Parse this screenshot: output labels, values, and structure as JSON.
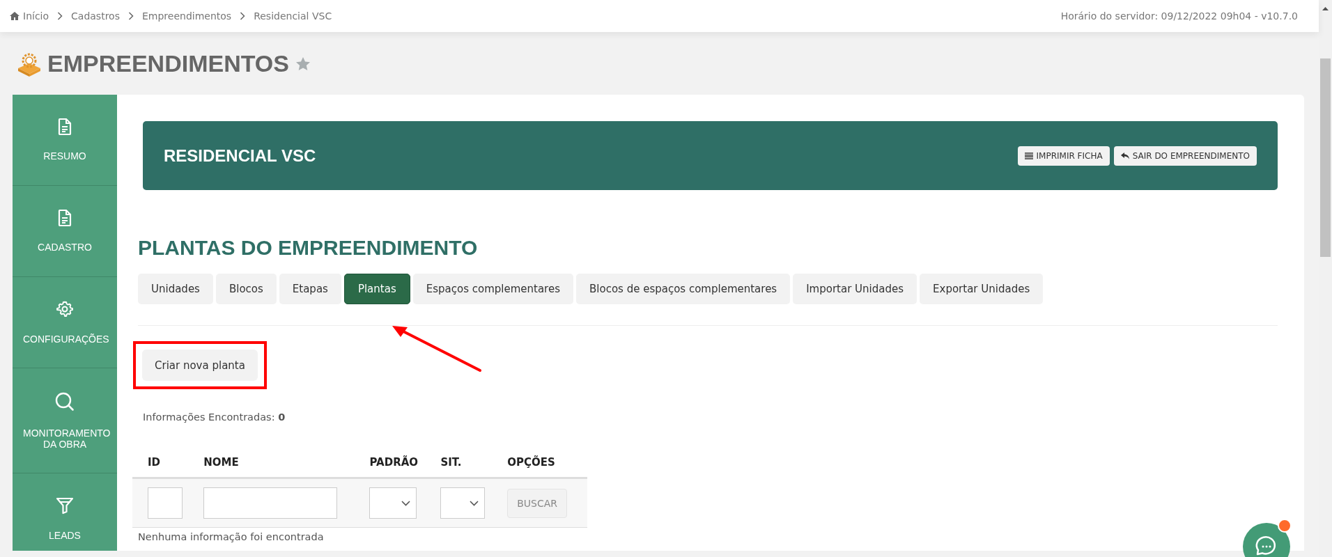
{
  "breadcrumb": [
    {
      "label": "Início",
      "kind": "home"
    },
    {
      "label": "Cadastros",
      "kind": "link"
    },
    {
      "label": "Empreendimentos",
      "kind": "link"
    },
    {
      "label": "Residencial VSC",
      "kind": "link"
    }
  ],
  "server_info": "Horário do servidor: 09/12/2022 09h04 - v10.7.0",
  "page": {
    "title": "EMPREENDIMENTOS",
    "favorite": false
  },
  "sidebar": {
    "items": [
      {
        "label": "RESUMO",
        "kind": "document"
      },
      {
        "label": "CADASTRO",
        "kind": "document"
      },
      {
        "label": "CONFIGURAÇÕES",
        "kind": "gear"
      },
      {
        "label": "MONITORAMENTO DA OBRA",
        "kind": "search"
      },
      {
        "label": "LEADS",
        "kind": "funnel"
      }
    ]
  },
  "header": {
    "title": "RESIDENCIAL VSC",
    "buttons": [
      {
        "label": "IMPRIMIR FICHA",
        "kind": "print"
      },
      {
        "label": "SAIR DO EMPREENDIMENTO",
        "kind": "exit"
      }
    ]
  },
  "section": {
    "title": "PLANTAS DO EMPREENDIMENTO"
  },
  "tabs": [
    {
      "label": "Unidades",
      "selected": false
    },
    {
      "label": "Blocos",
      "selected": false
    },
    {
      "label": "Etapas",
      "selected": false
    },
    {
      "label": "Plantas",
      "selected": true
    },
    {
      "label": "Espaços complementares",
      "selected": false
    },
    {
      "label": "Blocos de espaços complementares",
      "selected": false
    },
    {
      "label": "Importar Unidades",
      "selected": false
    },
    {
      "label": "Exportar Unidades",
      "selected": false
    }
  ],
  "create_button": {
    "label": "Criar nova planta",
    "highlighted": true
  },
  "results": {
    "label": "Informações Encontradas:",
    "count": "0"
  },
  "table": {
    "columns": [
      "ID",
      "NOME",
      "PADRÃO",
      "SIT.",
      "OPÇÕES"
    ],
    "filters": [
      {
        "kind": "text"
      },
      {
        "kind": "text"
      },
      {
        "kind": "select"
      },
      {
        "kind": "select"
      },
      {
        "kind": "button",
        "label": "BUSCAR"
      }
    ],
    "empty_message": "Nenhuma informação foi encontrada"
  },
  "annotations": [
    {
      "kind": "arrow"
    }
  ],
  "chat": {
    "unread": true
  }
}
